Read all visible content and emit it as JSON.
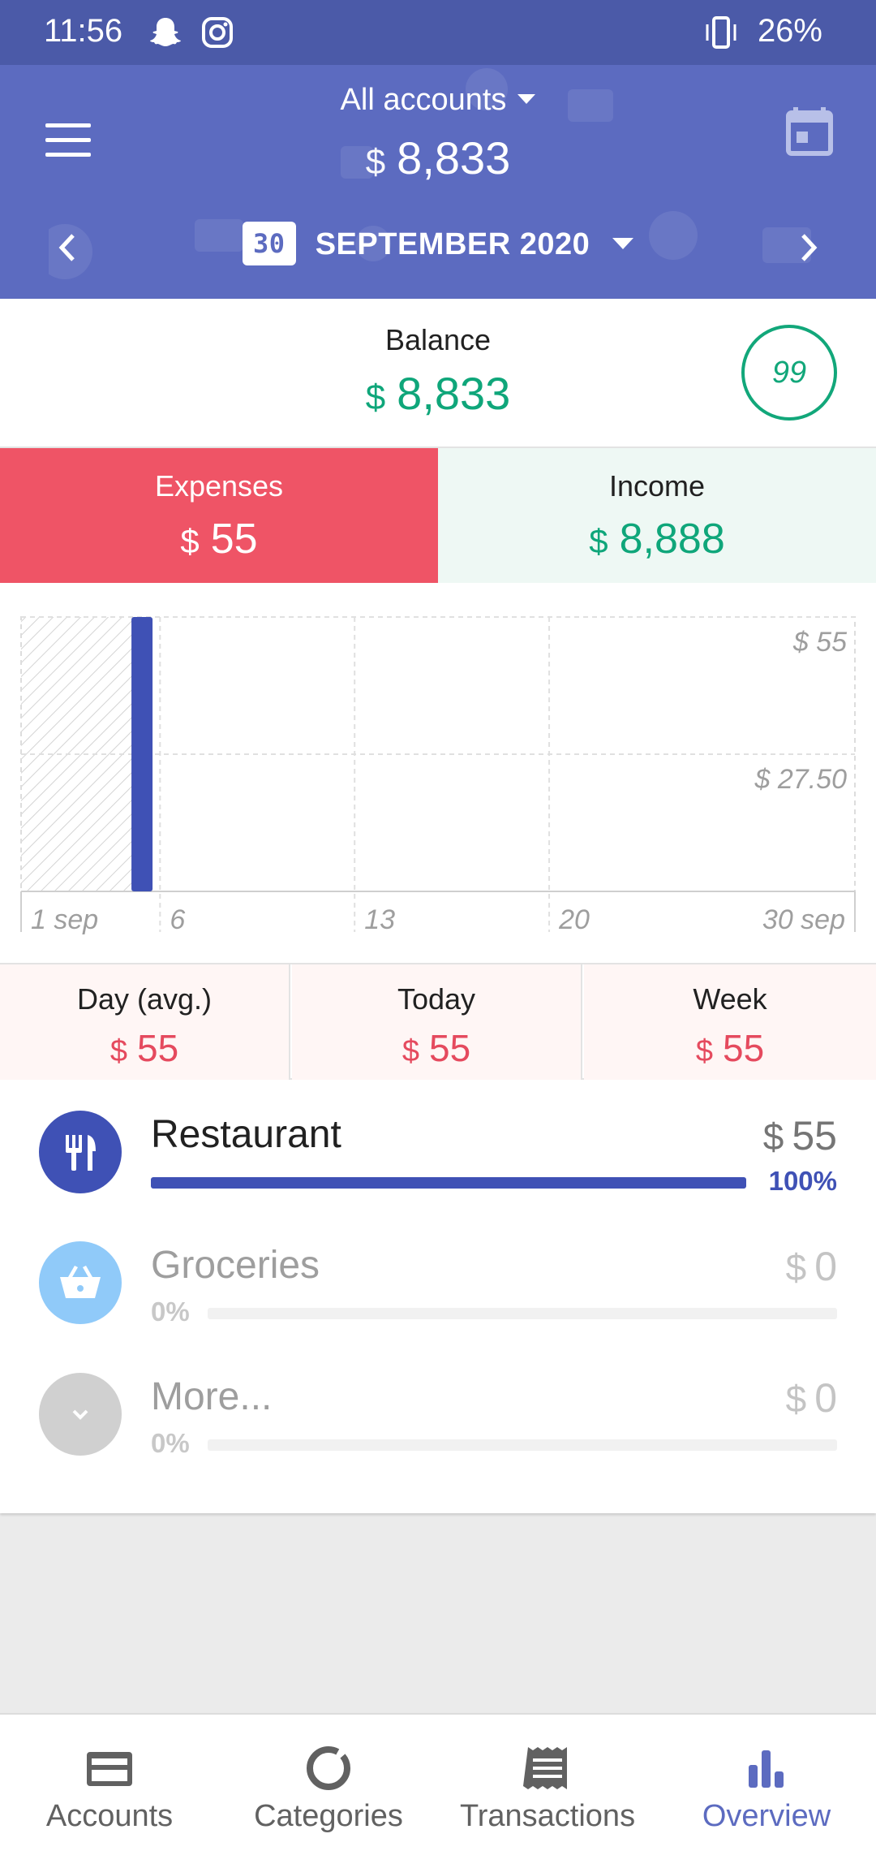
{
  "status_bar": {
    "time": "11:56",
    "battery": "26%",
    "icons": [
      "snapchat-icon",
      "instagram-icon",
      "vibrate-icon"
    ]
  },
  "header": {
    "account_selector": "All accounts",
    "total_currency": "$",
    "total_amount": "8,833",
    "day_badge": "30",
    "month": "SEPTEMBER 2020",
    "color": "#5c6bc0"
  },
  "balance": {
    "label": "Balance",
    "currency": "$",
    "amount": "8,833",
    "score": "99",
    "color": "#0fa67a"
  },
  "totals": {
    "expenses_label": "Expenses",
    "expenses_currency": "$",
    "expenses_amount": "55",
    "income_label": "Income",
    "income_currency": "$",
    "income_amount": "8,888",
    "expense_color": "#ef5466"
  },
  "chart_data": {
    "type": "bar",
    "title": "",
    "xlabel": "",
    "ylabel": "",
    "x_range": [
      1,
      30
    ],
    "x_tick_labels": [
      {
        "day": 1,
        "label": "1 sep"
      },
      {
        "day": 6,
        "label": "6"
      },
      {
        "day": 13,
        "label": "13"
      },
      {
        "day": 20,
        "label": "20"
      },
      {
        "day": 30,
        "label": "30 sep"
      }
    ],
    "y_tick_labels": [
      {
        "value": 55,
        "label": "$ 55"
      },
      {
        "value": 27.5,
        "label": "$ 27.50"
      }
    ],
    "ylim": [
      0,
      55
    ],
    "points": [
      {
        "day": 5,
        "value": 55
      }
    ],
    "shaded_before_day": 5,
    "grid": true,
    "bar_color": "#3f51b5"
  },
  "stats": [
    {
      "label": "Day (avg.)",
      "currency": "$",
      "amount": "55"
    },
    {
      "label": "Today",
      "currency": "$",
      "amount": "55"
    },
    {
      "label": "Week",
      "currency": "$",
      "amount": "55"
    }
  ],
  "categories": [
    {
      "name": "Restaurant",
      "currency": "$",
      "amount": "55",
      "percent": "100%",
      "fraction": 1.0,
      "icon": "cutlery-icon",
      "color": "#3f51b5"
    },
    {
      "name": "Groceries",
      "currency": "$",
      "amount": "0",
      "percent": "0%",
      "fraction": 0.0,
      "icon": "basket-icon",
      "color": "#90caf9"
    },
    {
      "name": "More...",
      "currency": "$",
      "amount": "0",
      "percent": "0%",
      "fraction": 0.0,
      "icon": "chevron-down-icon",
      "color": "#d0d0d0"
    }
  ],
  "bottom_nav": [
    {
      "label": "Accounts",
      "icon": "card-icon"
    },
    {
      "label": "Categories",
      "icon": "donut-icon"
    },
    {
      "label": "Transactions",
      "icon": "receipt-icon"
    },
    {
      "label": "Overview",
      "icon": "bar-chart-icon",
      "active": true
    }
  ]
}
